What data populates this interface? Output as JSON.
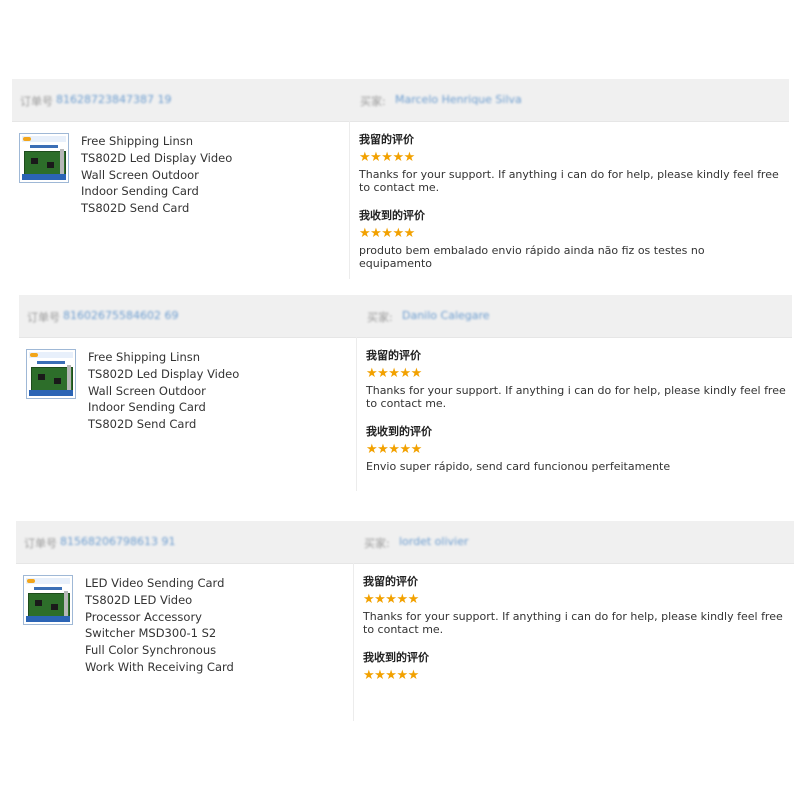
{
  "labels": {
    "order": "订单号",
    "buyer": "买家:",
    "my_review": "我留的评价",
    "received_review": "我收到的评价"
  },
  "colors": {
    "star": "#f2a100",
    "link": "#6b9ccf",
    "header_bg": "#f0f0f0"
  },
  "reviews": [
    {
      "order_number": "81628723847387 19",
      "buyer_name": "Marcelo Henrique Silva",
      "product_title": "Free Shipping Linsn\nTS802D Led Display Video\nWall Screen Outdoor\nIndoor Sending Card\nTS802D Send Card",
      "my_stars": "★★★★★",
      "my_review_text": "Thanks for your support. If anything i can do for help, please kindly feel free to contact me.",
      "received_stars": "★★★★★",
      "received_review_text": "produto bem embalado envio rápido ainda não fiz os testes no equipamento",
      "rating": 5
    },
    {
      "order_number": "81602675584602 69",
      "buyer_name": "Danilo Calegare",
      "product_title": "Free Shipping Linsn\nTS802D Led Display Video\nWall Screen Outdoor\nIndoor Sending Card\nTS802D Send Card",
      "my_stars": "★★★★★",
      "my_review_text": "Thanks for your support. If anything i can do for help, please kindly feel free to contact me.",
      "received_stars": "★★★★★",
      "received_review_text": "Envio super rápido, send card funcionou perfeitamente",
      "rating": 5
    },
    {
      "order_number": "81568206798613 91",
      "buyer_name": "lordet olivier",
      "product_title": "LED Video Sending Card\nTS802D LED Video\nProcessor Accessory\nSwitcher MSD300-1 S2\nFull Color Synchronous\nWork With Receiving Card",
      "my_stars": "★★★★★",
      "my_review_text": "Thanks for your support. If anything i can do for help, please kindly feel free to contact me.",
      "received_stars": "★★★★★",
      "received_review_text": "",
      "rating": 5
    }
  ]
}
